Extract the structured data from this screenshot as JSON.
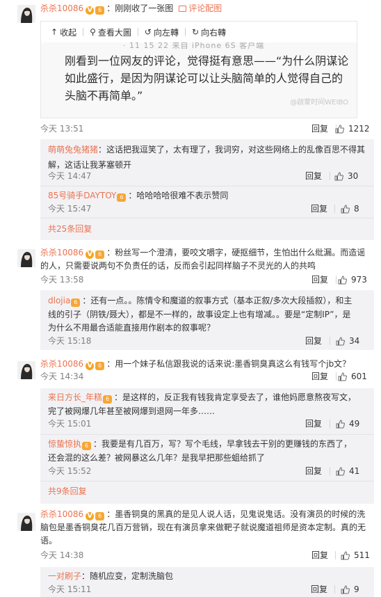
{
  "actions": {
    "reply": "回复"
  },
  "c1": {
    "user": "杀杀10086",
    "text": "：刚刚收了一张图",
    "pic_link": "评论配图",
    "toolbar": {
      "collapse": "收起",
      "view_large": "查看大圖",
      "rotate_left": "向左轉",
      "rotate_right": "向右轉"
    },
    "image": {
      "cut_text": "· 11 15 22  来自 iPhone 6S  客户端",
      "text": "刚看到一位网友的评论，觉得挺有意思——“为什么阴谋论如此盛行，是因为阴谋论可以让头脑简单的人觉得自己的头脑不再简单。”",
      "watermark": "@啟蒙时间WEIBO"
    },
    "time": "今天 13:51",
    "likes": "1212",
    "replies": [
      {
        "user": "萌萌兔兔猪猪",
        "text": "：这话把我逗笑了，太有理了，我词穷，对这些网络上的乱像百思不得其解，这话让我茅塞顿开",
        "time": "今天 14:47",
        "likes": "30"
      },
      {
        "user": "85号骑手DAYTOY",
        "text": "：哈哈哈哈很难不表示赞同",
        "time": "今天 15:47",
        "likes": "8"
      }
    ],
    "more": "共25条回复"
  },
  "c2": {
    "user": "杀杀10086",
    "text_line1": "：粉丝写一个澄清，要咬文嚼字，硬抠细节，生怕出什么纰漏。而造谣",
    "text_line2": "的人，只需要说两句不负责任的话，反而会引起同样脑子不灵光的人的共鸣",
    "time": "今天 13:58",
    "likes": "973",
    "replies": [
      {
        "user": "dlojia",
        "line1": "：还有一点。。陈情令和魔道的叙事方式（基本正叙/多次大段插叙），和主",
        "line2": "线的引子（阴铁/聂大），都是不一样的，故事设定上也有增减。。要是“定制IP”，是",
        "line3": "为什么不用最合适能直接用作剧本的叙事呢？",
        "time": "今天 15:18",
        "likes": "34"
      }
    ]
  },
  "c3": {
    "user": "杀杀10086",
    "text": "：用一个妹子私信跟我说的话来说:墨香铜臭真这么有钱写个jb文？",
    "time": "今天 14:34",
    "likes": "601",
    "replies": [
      {
        "user": "来日方长_年糕",
        "line1": "：是这样的，反正我有钱我肯定享受去了，谁他妈愿意熬夜写文，",
        "line2": "完了被网爆几年甚至被网爆到退网一年多……",
        "time": "今天 15:01",
        "likes": "49"
      },
      {
        "user": "惊蛰惊执",
        "line1": "：我要是有几百万，写？写个毛线，早拿钱去干别的更赚钱的东西了，",
        "line2": "还会混的这么差？被网暴这么几年？是我早把那些蛆给抓了",
        "time": "今天 15:52",
        "likes": "41"
      }
    ],
    "more": "共9条回复"
  },
  "c4": {
    "user": "杀杀10086",
    "text_line1": "：墨香铜臭的黑真的是见人说人话，见鬼说鬼话。没有演员的时候的洗",
    "text_line2": "脑包是墨香铜臭花几百万营销，现在有演员拿来做靶子就说魔道祖师是资本定制。真的无",
    "text_line3": "语。",
    "time": "今天 14:38",
    "likes": "511",
    "replies": [
      {
        "user": "一对刷子",
        "text": "：随机应变，定制洗脑包",
        "time": "今天 15:11",
        "likes": "9"
      }
    ]
  }
}
